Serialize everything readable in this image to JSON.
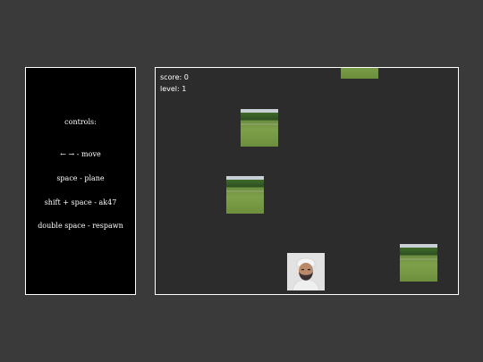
{
  "controls": {
    "title": "controls:",
    "lines": [
      "← → - move",
      "space - plane",
      "shift + space - ak47",
      "double space - respawn"
    ]
  },
  "hud": {
    "score": "score: 0",
    "level": "level: 1"
  },
  "sprites": {
    "obstacle": "field-image",
    "player": "face-portrait"
  }
}
